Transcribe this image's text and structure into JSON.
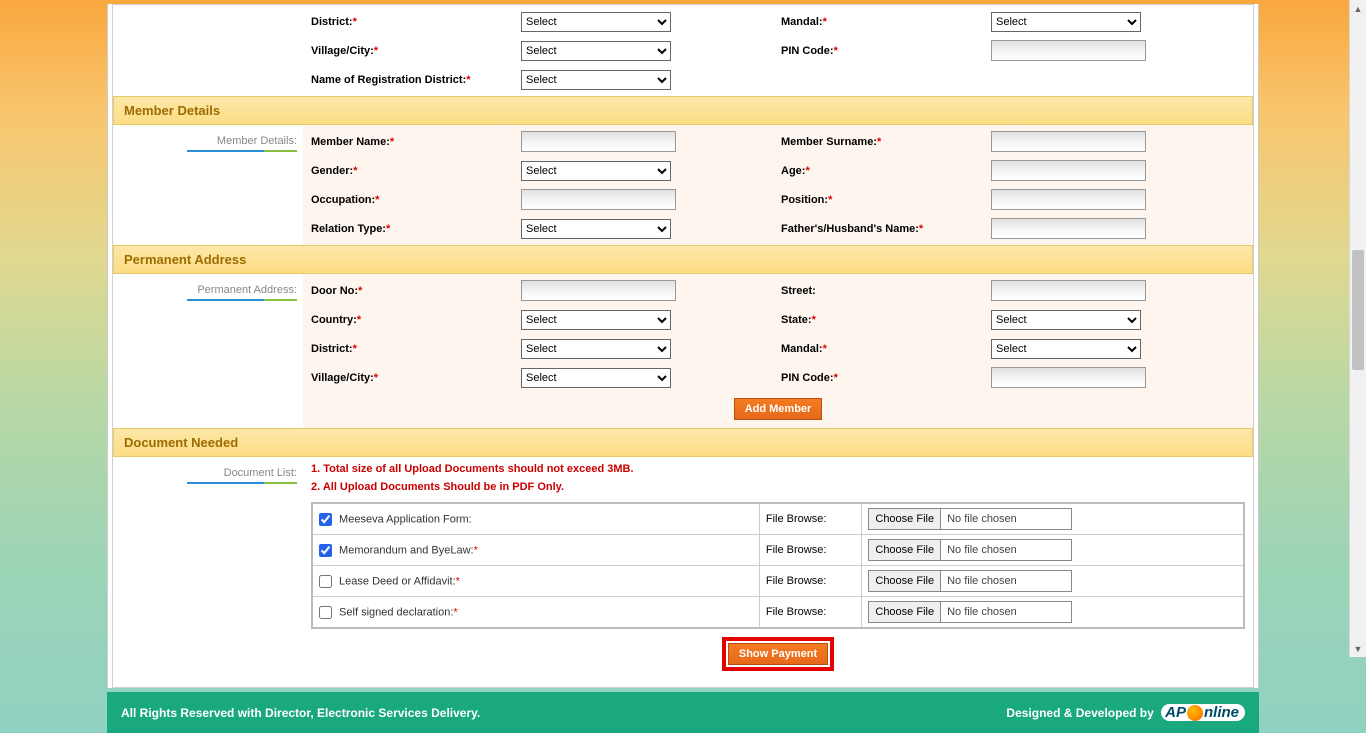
{
  "top_fields": {
    "district_label": "District:",
    "mandal_label": "Mandal:",
    "village_label": "Village/City:",
    "pincode_label": "PIN Code:",
    "reg_district_label": "Name of Registration District:",
    "select": "Select"
  },
  "member": {
    "section": "Member Details",
    "side": "Member Details:",
    "name_label": "Member Name:",
    "surname_label": "Member Surname:",
    "gender_label": "Gender:",
    "age_label": "Age:",
    "occupation_label": "Occupation:",
    "position_label": "Position:",
    "relation_label": "Relation Type:",
    "father_label": "Father's/Husband's Name:",
    "select": "Select"
  },
  "perm": {
    "section": "Permanent Address",
    "side": "Permanent Address:",
    "door_label": "Door No:",
    "street_label": "Street:",
    "country_label": "Country:",
    "state_label": "State:",
    "district_label": "District:",
    "mandal_label": "Mandal:",
    "village_label": "Village/City:",
    "pincode_label": "PIN Code:",
    "add_member": "Add Member",
    "select": "Select"
  },
  "doc": {
    "section": "Document Needed",
    "side": "Document List:",
    "note1": "1. Total size of all Upload Documents should not exceed 3MB.",
    "note2": "2. All Upload Documents Should be in PDF Only.",
    "browse_label": "File Browse:",
    "choose_file": "Choose File",
    "no_file": "No file chosen",
    "items": [
      {
        "label": "Meeseva Application Form:",
        "checked": true,
        "required": false
      },
      {
        "label": "Memorandum and ByeLaw:",
        "checked": true,
        "required": true
      },
      {
        "label": "Lease Deed or Affidavit:",
        "checked": false,
        "required": true
      },
      {
        "label": "Self signed declaration:",
        "checked": false,
        "required": true
      }
    ],
    "show_payment": "Show Payment"
  },
  "footer": {
    "left": "All Rights Reserved with Director, Electronic Services Delivery.",
    "right": "Designed & Developed by",
    "logo_ap": "AP",
    "logo_nline": "nline"
  }
}
